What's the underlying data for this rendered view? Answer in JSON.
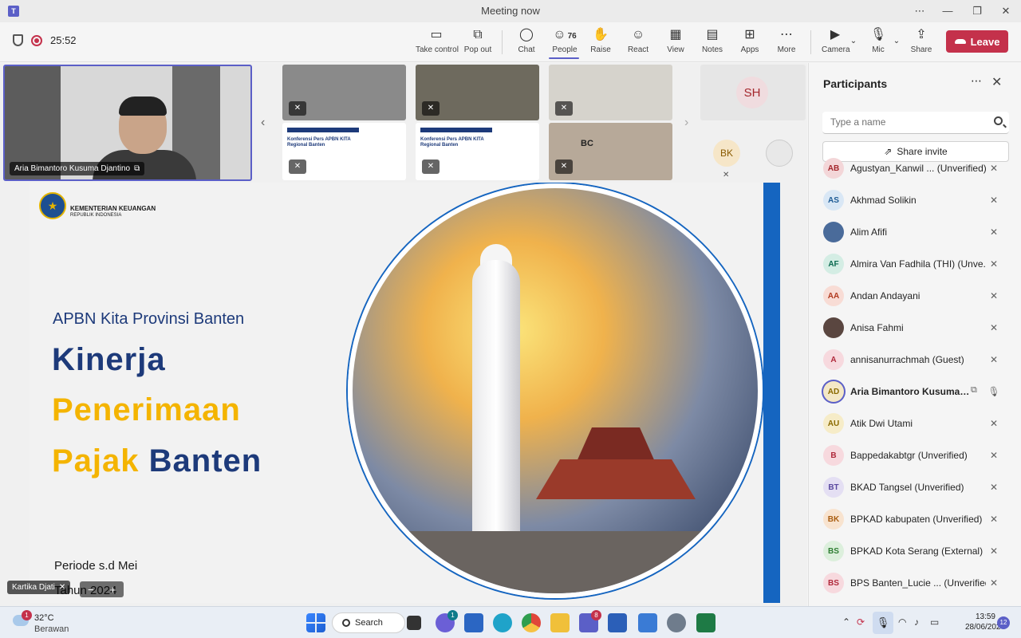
{
  "window": {
    "title": "Meeting now"
  },
  "recording": {
    "timer": "25:52"
  },
  "toolbar": {
    "take_control": "Take control",
    "pop_out": "Pop out",
    "chat": "Chat",
    "people": "People",
    "people_count": "76",
    "raise": "Raise",
    "react": "React",
    "view": "View",
    "notes": "Notes",
    "apps": "Apps",
    "more": "More",
    "camera": "Camera",
    "mic": "Mic",
    "share": "Share",
    "leave": "Leave"
  },
  "stage": {
    "main_speaker": "Aria Bimantoro Kusuma Djantino",
    "tile_initials_1": "SH",
    "tile_initials_2": "BK",
    "bottom_participant": "Kartika Djati",
    "thumb_slide_title": "Konferensi Pers APBN KITA Regional Banten",
    "thumb_room_sign": "BC"
  },
  "slide": {
    "org_line1": "KEMENTERIAN KEUANGAN",
    "org_line2": "REPUBLIK INDONESIA",
    "subtitle": "APBN Kita Provinsi Banten",
    "title_line1": "Kinerja",
    "title_line2": "Penerimaan",
    "title_line3_a": "Pajak",
    "title_line3_b": "Banten",
    "period": "Periode s.d Mei",
    "year": "Tahun 2024"
  },
  "participants": {
    "title": "Participants",
    "search_placeholder": "Type a name",
    "share_invite": "Share invite",
    "list": [
      {
        "initials": "AB",
        "name": "Agustyan_Kanwil ...  (Unverified)",
        "color": "#f3d6d8",
        "fg": "#a4262c"
      },
      {
        "initials": "AS",
        "name": "Akhmad Solikin",
        "color": "#d9e7f5",
        "fg": "#1e5b94"
      },
      {
        "initials": "",
        "name": "Alim Afifi",
        "color": "#4a6b9a",
        "fg": "#fff"
      },
      {
        "initials": "AF",
        "name": "Almira Van Fadhila (THI) (Unve...",
        "color": "#d4ede4",
        "fg": "#0b6a50"
      },
      {
        "initials": "AA",
        "name": "Andan Andayani",
        "color": "#f8dcd5",
        "fg": "#b13a1f"
      },
      {
        "initials": "",
        "name": "Anisa Fahmi",
        "color": "#5a4640",
        "fg": "#fff"
      },
      {
        "initials": "A",
        "name": "annisanurrachmah (Guest)",
        "color": "#f7d9de",
        "fg": "#b0293b"
      },
      {
        "initials": "AD",
        "name": "Aria Bimantoro Kusuma D...",
        "color": "#f4e8c6",
        "fg": "#8a6a00"
      },
      {
        "initials": "AU",
        "name": "Atik Dwi Utami",
        "color": "#f6ecc8",
        "fg": "#8a6a00"
      },
      {
        "initials": "B",
        "name": "Bappedakabtgr (Unverified)",
        "color": "#f7d9de",
        "fg": "#b0293b"
      },
      {
        "initials": "BT",
        "name": "BKAD Tangsel (Unverified)",
        "color": "#e4dff3",
        "fg": "#5b4aa0"
      },
      {
        "initials": "BK",
        "name": "BPKAD kabupaten (Unverified)",
        "color": "#f8e3cf",
        "fg": "#a95d10"
      },
      {
        "initials": "BS",
        "name": "BPKAD Kota Serang (External)",
        "color": "#dcefdc",
        "fg": "#2e7d32"
      },
      {
        "initials": "BS",
        "name": "BPS Banten_Lucie ...  (Unverified)",
        "color": "#f7d9de",
        "fg": "#b0293b"
      }
    ]
  },
  "taskbar": {
    "weather_badge": "1",
    "temperature": "32°C",
    "weather": "Berawan",
    "search": "Search",
    "chat_badge": "1",
    "teams_badge": "8",
    "time": "13:59",
    "date": "28/06/2024",
    "notifications": "12"
  },
  "colors": {
    "accent": "#5b5fc7",
    "leave": "#c4314b",
    "slide_blue": "#1d3a7a",
    "slide_yellow": "#f4b400"
  }
}
